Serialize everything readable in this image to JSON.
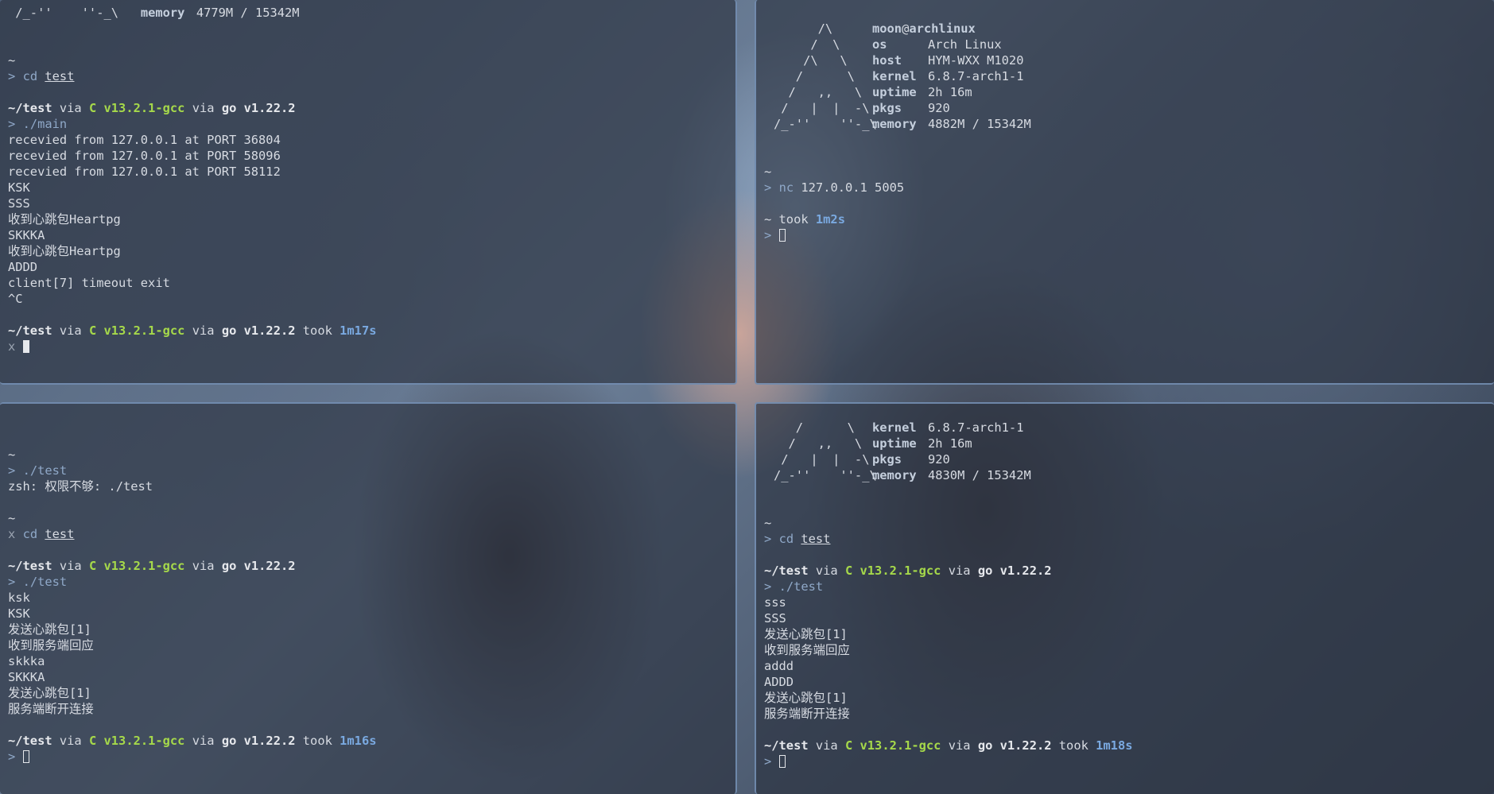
{
  "pane_top_left": {
    "head_art": " /_-''    ''-_\\",
    "head_key": "memory",
    "head_val": "4779M / 15342M",
    "tilde1": "~",
    "prompt": ">",
    "cmd_cd": "cd",
    "arg_test": "test",
    "dir": "~/test",
    "via": "via",
    "c_label": "C v13.2.1-gcc",
    "go_label": "go v1.22.2",
    "run_cmd": "./main",
    "output": [
      "recevied from 127.0.0.1 at PORT 36804",
      "recevied from 127.0.0.1 at PORT 58096",
      "recevied from 127.0.0.1 at PORT 58112",
      "KSK",
      "SSS",
      "收到心跳包Heartpg",
      "SKKKA",
      "收到心跳包Heartpg",
      "ADDD",
      "client[7] timeout exit",
      "^C"
    ],
    "took": "took",
    "took_time": "1m17s",
    "err_prompt": "x"
  },
  "pane_top_right": {
    "art": [
      "      /\\",
      "     /  \\",
      "    /\\   \\",
      "   /      \\",
      "  /   ,,   \\",
      " /   |  |  -\\",
      "/_-''    ''-_\\"
    ],
    "user": "moon",
    "at": "@",
    "hostname": "archlinux",
    "info": [
      {
        "k": "os",
        "v": "Arch Linux"
      },
      {
        "k": "host",
        "v": "HYM-WXX M1020"
      },
      {
        "k": "kernel",
        "v": "6.8.7-arch1-1"
      },
      {
        "k": "uptime",
        "v": "2h 16m"
      },
      {
        "k": "pkgs",
        "v": "920"
      },
      {
        "k": "memory",
        "v": "4882M / 15342M"
      }
    ],
    "tilde": "~",
    "prompt": ">",
    "cmd": "nc",
    "cmd_args": "127.0.0.1 5005",
    "took_prefix": "~ took",
    "took_time": "1m2s"
  },
  "pane_bottom_left": {
    "tilde": "~",
    "prompt": ">",
    "run_cmd": "./test",
    "zsh_err": "zsh: 权限不够: ./test",
    "err_prompt": "x",
    "cmd_cd": "cd",
    "arg_test": "test",
    "dir": "~/test",
    "via": "via",
    "c_label": "C v13.2.1-gcc",
    "go_label": "go v1.22.2",
    "output": [
      "ksk",
      "KSK",
      "发送心跳包[1]",
      "收到服务端回应",
      "skkka",
      "SKKKA",
      "发送心跳包[1]",
      "服务端断开连接"
    ],
    "took": "took",
    "took_time": "1m16s"
  },
  "pane_bottom_right": {
    "art": [
      "   /      \\",
      "  /   ,,   \\",
      " /   |  |  -\\",
      "/_-''    ''-_\\"
    ],
    "info": [
      {
        "k": "kernel",
        "v": "6.8.7-arch1-1"
      },
      {
        "k": "uptime",
        "v": "2h 16m"
      },
      {
        "k": "pkgs",
        "v": "920"
      },
      {
        "k": "memory",
        "v": "4830M / 15342M"
      }
    ],
    "tilde": "~",
    "prompt": ">",
    "cmd_cd": "cd",
    "arg_test": "test",
    "dir": "~/test",
    "via": "via",
    "c_label": "C v13.2.1-gcc",
    "go_label": "go v1.22.2",
    "run_cmd": "./test",
    "output": [
      "sss",
      "SSS",
      "发送心跳包[1]",
      "收到服务端回应",
      "addd",
      "ADDD",
      "发送心跳包[1]",
      "服务端断开连接"
    ],
    "took": "took",
    "took_time": "1m18s"
  },
  "colors": {
    "c_version": "#a6d94a",
    "took_time": "#7aa9e0",
    "prompt": "#8fa8c8",
    "pane_border": "#82a0c8"
  }
}
